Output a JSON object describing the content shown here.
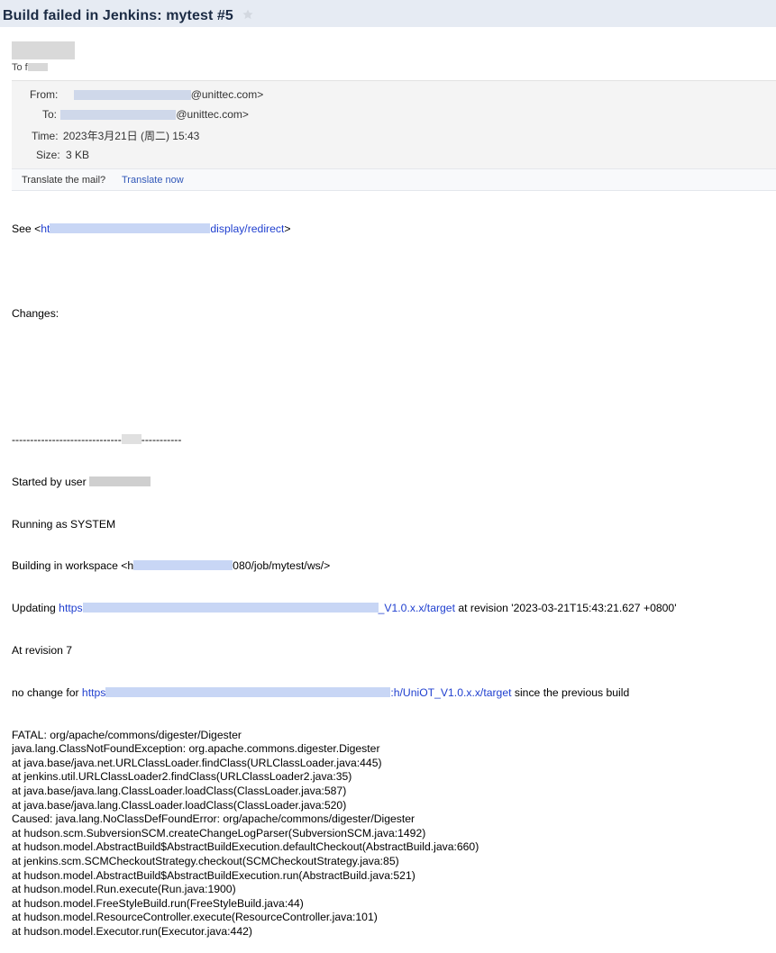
{
  "subject": "Build failed in Jenkins: mytest #5",
  "to_prefix": "To f",
  "meta": {
    "from_label": "From:",
    "from_domain": "@unittec.com>",
    "to_label": "To:",
    "to_domain": "@unittec.com>",
    "time_label": "Time:",
    "time_value": "2023年3月21日 (周二) 15:43",
    "size_label": "Size:",
    "size_value": "3 KB"
  },
  "translate": {
    "question": "Translate the mail?",
    "link": "Translate now"
  },
  "body": {
    "see_prefix": "See <",
    "see_link_start": "ht",
    "see_link_end": "display/redirect",
    "see_suffix": ">",
    "changes": "Changes:",
    "separator": "------------------------------",
    "separator_tail": "-----------",
    "started_by": "Started by user ",
    "running_as": "Running as SYSTEM",
    "building_in": "Building in workspace <h",
    "building_tail": "080/job/mytest/ws/>",
    "updating": "Updating ",
    "https": "https",
    "updating_link_end": "_V1.0.x.x/target",
    "updating_rest": " at revision '2023-03-21T15:43:21.627 +0800'",
    "at_revision": "At revision 7",
    "no_change": "no change for ",
    "nochange_link_end": ":h/UniOT_V1.0.x.x/target",
    "nochange_rest": " since the previous build",
    "trace": [
      "FATAL: org/apache/commons/digester/Digester",
      "java.lang.ClassNotFoundException: org.apache.commons.digester.Digester",
      "at java.base/java.net.URLClassLoader.findClass(URLClassLoader.java:445)",
      "at jenkins.util.URLClassLoader2.findClass(URLClassLoader2.java:35)",
      "at java.base/java.lang.ClassLoader.loadClass(ClassLoader.java:587)",
      "at java.base/java.lang.ClassLoader.loadClass(ClassLoader.java:520)",
      "Caused: java.lang.NoClassDefFoundError: org/apache/commons/digester/Digester",
      "at hudson.scm.SubversionSCM.createChangeLogParser(SubversionSCM.java:1492)",
      "at hudson.model.AbstractBuild$AbstractBuildExecution.defaultCheckout(AbstractBuild.java:660)",
      "at jenkins.scm.SCMCheckoutStrategy.checkout(SCMCheckoutStrategy.java:85)",
      "at hudson.model.AbstractBuild$AbstractBuildExecution.run(AbstractBuild.java:521)",
      "at hudson.model.Run.execute(Run.java:1900)",
      "at hudson.model.FreeStyleBuild.run(FreeStyleBuild.java:44)",
      "at hudson.model.ResourceController.execute(ResourceController.java:101)",
      "at hudson.model.Executor.run(Executor.java:442)"
    ]
  },
  "colors": {
    "link": "#1f3fcf",
    "titlebar": "#e6ebf3",
    "meta_bg": "#f4f4f4"
  },
  "icons": {
    "star": "star-icon"
  }
}
